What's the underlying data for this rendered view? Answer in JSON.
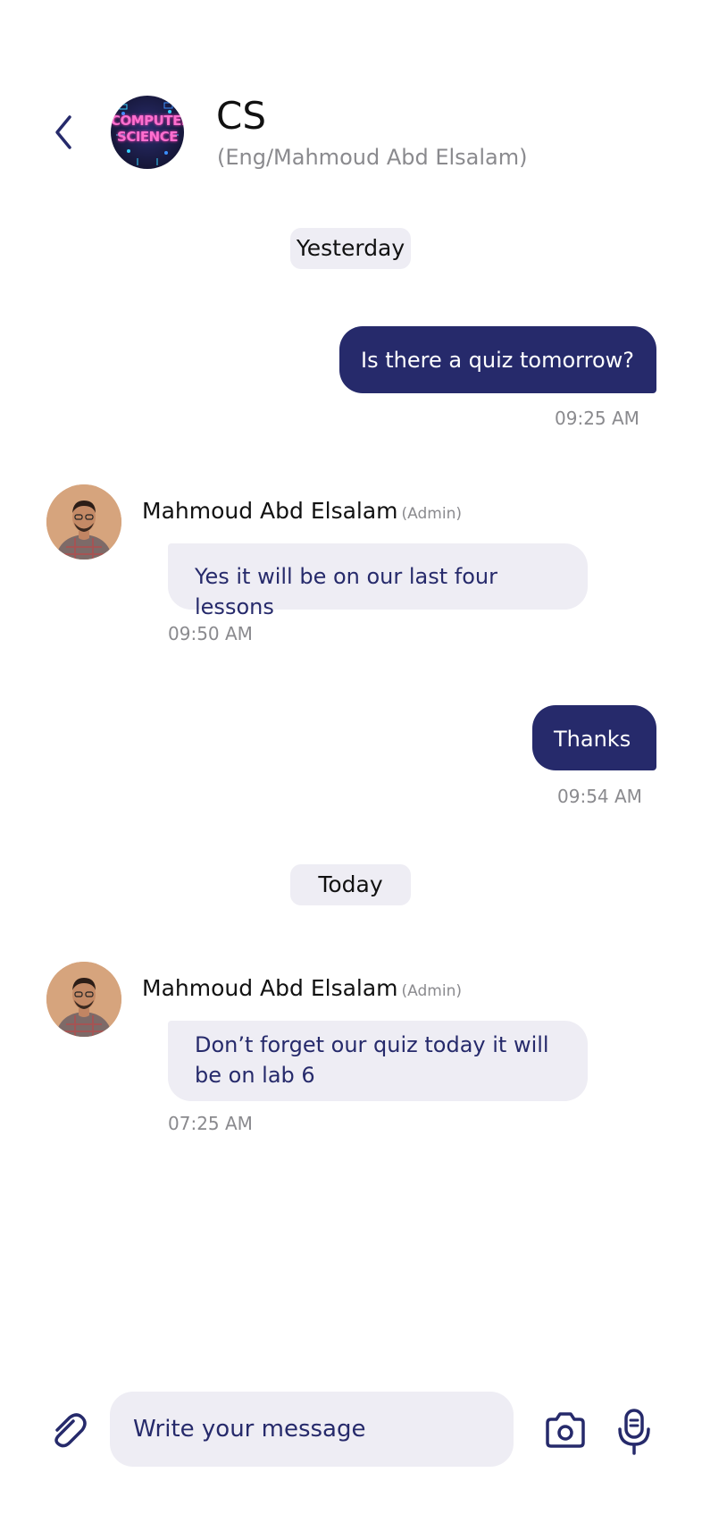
{
  "header": {
    "title": "CS",
    "subtitle": "(Eng/Mahmoud Abd Elsalam)",
    "group_logo_line1": "COMPUTER",
    "group_logo_line2": "SCIENCE"
  },
  "dates": {
    "yesterday": "Yesterday",
    "today": "Today"
  },
  "messages": [
    {
      "direction": "out",
      "text": "Is there a quiz tomorrow?",
      "time": "09:25 AM"
    },
    {
      "direction": "in",
      "sender": "Mahmoud Abd Elsalam",
      "role": "(Admin)",
      "text": "Yes it will be on our last four lessons",
      "time": "09:50 AM"
    },
    {
      "direction": "out",
      "text": "Thanks",
      "time": "09:54 AM"
    },
    {
      "direction": "in",
      "sender": "Mahmoud Abd Elsalam",
      "role": "(Admin)",
      "text": "Don’t forget our quiz today it will be on lab 6",
      "time": "07:25 AM"
    }
  ],
  "composer": {
    "placeholder": "Write your message"
  },
  "icons": {
    "back": "chevron-left-icon",
    "attach": "paperclip-icon",
    "camera": "camera-icon",
    "mic": "microphone-icon"
  },
  "colors": {
    "accent": "#262a6b",
    "bubble_in": "#eeedf4",
    "muted": "#8a8a8e"
  }
}
